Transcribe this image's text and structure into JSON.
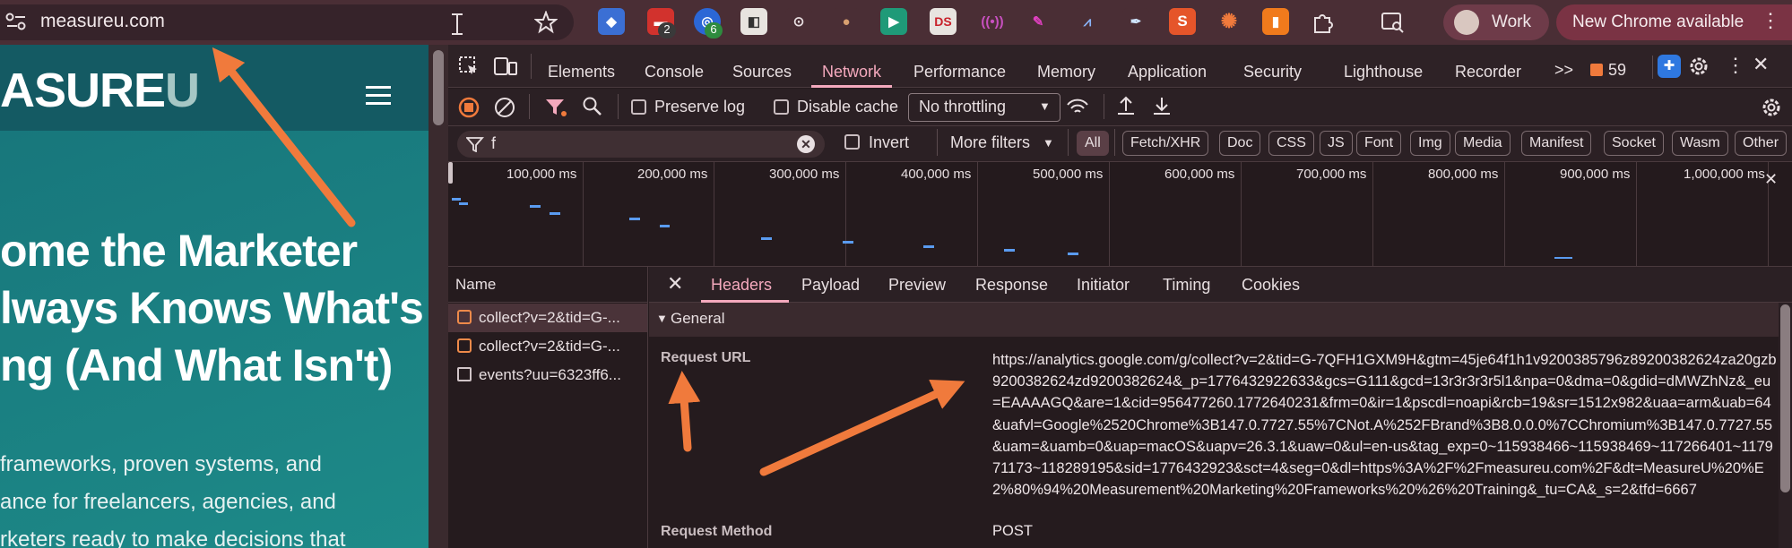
{
  "browser": {
    "url": "measureu.com",
    "profile_label": "Work",
    "update_label": "New Chrome available",
    "extension_badges": [
      "2",
      "6"
    ],
    "extension_ds_label": "DS",
    "extension_s_label": "S"
  },
  "website": {
    "logo_main": "ASURE",
    "logo_accent": "U",
    "hero_lines": [
      "ome the Marketer",
      "lways Knows What's",
      "ng (And What Isn't)"
    ],
    "description_lines": [
      "frameworks, proven systems, and",
      "ance for freelancers, agencies, and",
      "rketers ready to make decisions that"
    ]
  },
  "devtools": {
    "tabs": [
      "Elements",
      "Console",
      "Sources",
      "Network",
      "Performance",
      "Memory",
      "Application",
      "Security",
      "Lighthouse",
      "Recorder"
    ],
    "more_tabs_label": ">>",
    "issues_count": "59",
    "toolbar": {
      "preserve_log": "Preserve log",
      "disable_cache": "Disable cache",
      "throttling": "No throttling"
    },
    "filter": {
      "value": "f",
      "invert_label": "Invert",
      "more_filters_label": "More filters",
      "types": [
        "All",
        "Fetch/XHR",
        "Doc",
        "CSS",
        "JS",
        "Font",
        "Img",
        "Media",
        "Manifest",
        "Socket",
        "Wasm",
        "Other"
      ]
    },
    "timeline_ticks": [
      "100,000 ms",
      "200,000 ms",
      "300,000 ms",
      "400,000 ms",
      "500,000 ms",
      "600,000 ms",
      "700,000 ms",
      "800,000 ms",
      "900,000 ms",
      "1,000,000 ms"
    ],
    "name_header": "Name",
    "requests": [
      "collect?v=2&tid=G-...",
      "collect?v=2&tid=G-...",
      "events?uu=6323ff6..."
    ],
    "detail_tabs": [
      "Headers",
      "Payload",
      "Preview",
      "Response",
      "Initiator",
      "Timing",
      "Cookies"
    ],
    "general_label": "General",
    "request_url_label": "Request URL",
    "request_url": "https://analytics.google.com/g/collect?v=2&tid=G-7QFH1GXM9H&gtm=45je64f1h1v9200385796z89200382624za20gzb9200382624zd9200382624&_p=1776432922633&gcs=G111&gcd=13r3r3r3r5l1&npa=0&dma=0&gdid=dMWZhNz&_eu=EAAAAGQ&are=1&cid=956477260.1772640231&frm=0&ir=1&pscdl=noapi&rcb=19&sr=1512x982&uaa=arm&uab=64&uafvl=Google%2520Chrome%3B147.0.7727.55%7CNot.A%252FBrand%3B8.0.0.0%7CChromium%3B147.0.7727.55&uam=&uamb=0&uap=macOS&uapv=26.3.1&uaw=0&ul=en-us&tag_exp=0~115938466~115938469~117266401~117971173~118289195&sid=1776432923&sct=4&seg=0&dl=https%3A%2F%2Fmeasureu.com%2F&dt=MeasureU%20%E2%80%94%20Measurement%20Marketing%20Frameworks%20%26%20Training&_tu=CA&_s=2&tfd=6667",
    "request_method_label": "Request Method",
    "request_method": "POST"
  },
  "colors": {
    "annotation_arrow": "#f07a3c",
    "network_accent": "#f4a9bd",
    "timeline_bar": "#5a9bf0",
    "site_teal": "#17747a"
  }
}
